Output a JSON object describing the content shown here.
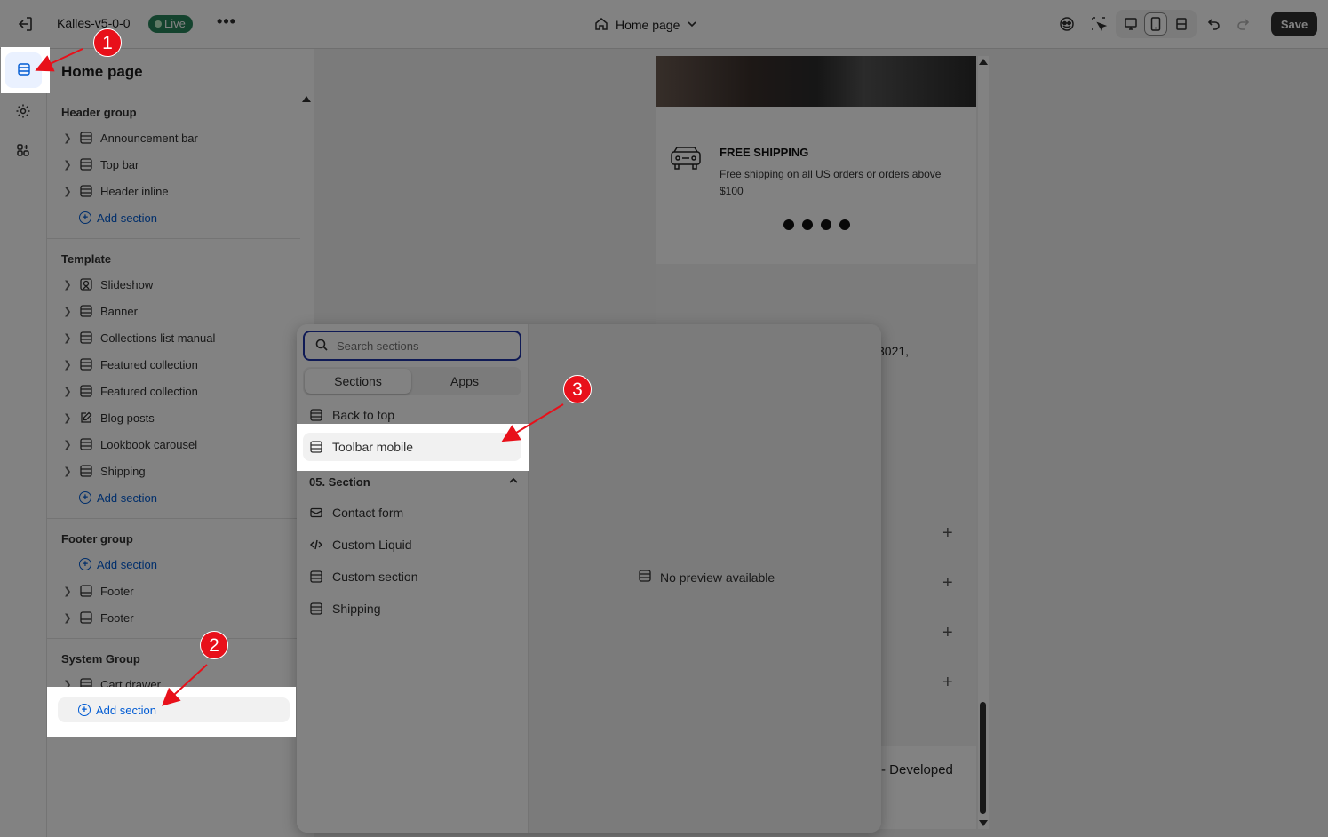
{
  "topbar": {
    "store_name": "Kalles-v5-0-0",
    "live_badge": "Live",
    "more_label": "•••",
    "page_select": "Home page",
    "save_label": "Save",
    "accent_live": "#29845a"
  },
  "sidebar": {
    "title": "Home page",
    "groups": [
      {
        "title": "Header group",
        "items": [
          "Announcement bar",
          "Top bar",
          "Header inline"
        ],
        "add_label": "Add section"
      },
      {
        "title": "Template",
        "items": [
          "Slideshow",
          "Banner",
          "Collections list manual",
          "Featured collection",
          "Featured collection",
          "Blog posts",
          "Lookbook carousel",
          "Shipping"
        ],
        "add_label": "Add section"
      },
      {
        "title": "Footer group",
        "add_label": "Add section",
        "items": [
          "Footer",
          "Footer"
        ]
      },
      {
        "title": "System Group",
        "items": [
          "Cart drawer"
        ],
        "add_label": "Add section"
      }
    ]
  },
  "preview": {
    "shipping_title": "FREE SHIPPING",
    "shipping_text": "Free shipping on all US orders or orders above $100",
    "partial_text": "3021,",
    "footer_text": "- Developed"
  },
  "popover": {
    "search_placeholder": "Search sections",
    "tabs": [
      "Sections",
      "Apps"
    ],
    "items_top": [
      "Back to top",
      "Toolbar mobile"
    ],
    "category": "05. Section",
    "items": [
      "Contact form",
      "Custom Liquid",
      "Custom section",
      "Shipping"
    ],
    "no_preview": "No preview available"
  },
  "annotations": [
    "1",
    "2",
    "3"
  ]
}
